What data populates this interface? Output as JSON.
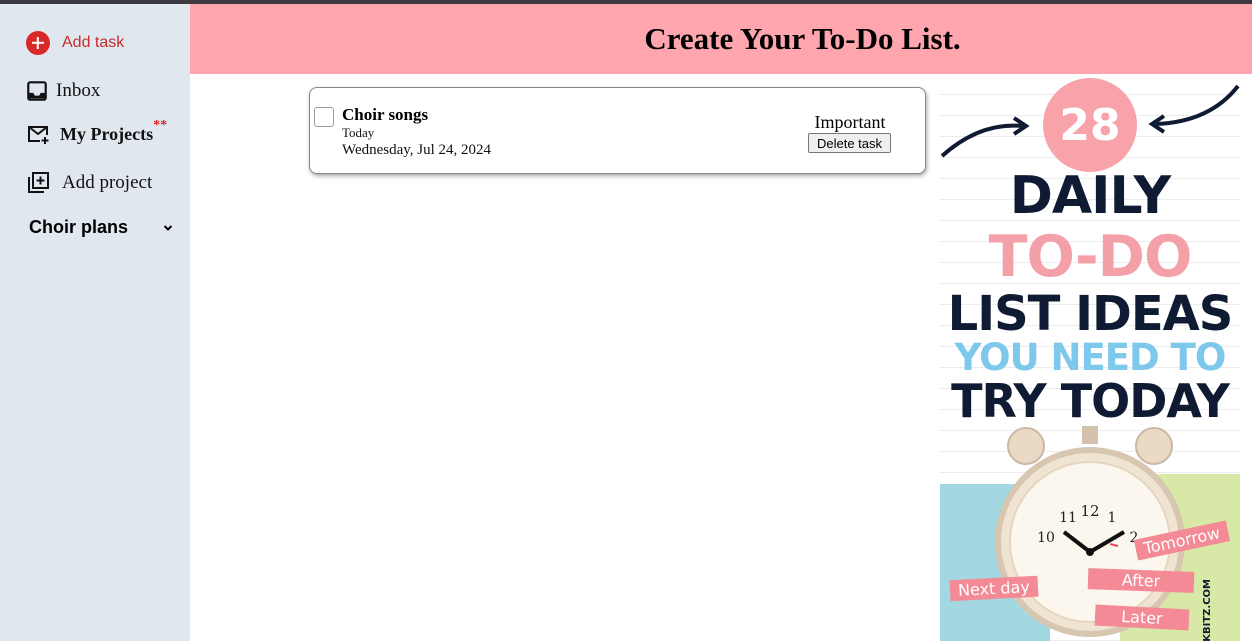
{
  "sidebar": {
    "add_task": "Add task",
    "inbox": "Inbox",
    "my_projects": "My Projects",
    "my_projects_marker": "**",
    "add_project": "Add project",
    "project_group": "Choir plans"
  },
  "header": {
    "title": "Create Your To-Do List."
  },
  "tasks": [
    {
      "title": "Choir songs",
      "when": "Today",
      "date": "Wednesday, Jul 24, 2024",
      "priority": "Important",
      "delete_label": "Delete task",
      "completed": false
    }
  ],
  "promo": {
    "badge": "28",
    "line1": "DAILY",
    "line2": "TO-DO",
    "line3": "LIST IDEAS",
    "line4": "YOU NEED TO",
    "line5": "TRY TODAY",
    "tag_tomorrow": "Tomorrow",
    "tag_next_day": "Next day",
    "tag_after": "After",
    "tag_later": "Later",
    "site": "LKBITZ.COM"
  },
  "colors": {
    "header_bg": "#fea5ad",
    "sidebar_bg": "#e1e7ef",
    "add_task_accent": "#d92a2a",
    "marker": "#e02020"
  },
  "icons": {
    "add_task": "plus-circle-icon",
    "inbox": "inbox-tray-icon",
    "my_projects": "mail-plus-icon",
    "add_project": "library-add-icon",
    "project_group": "chevron-down-icon"
  }
}
